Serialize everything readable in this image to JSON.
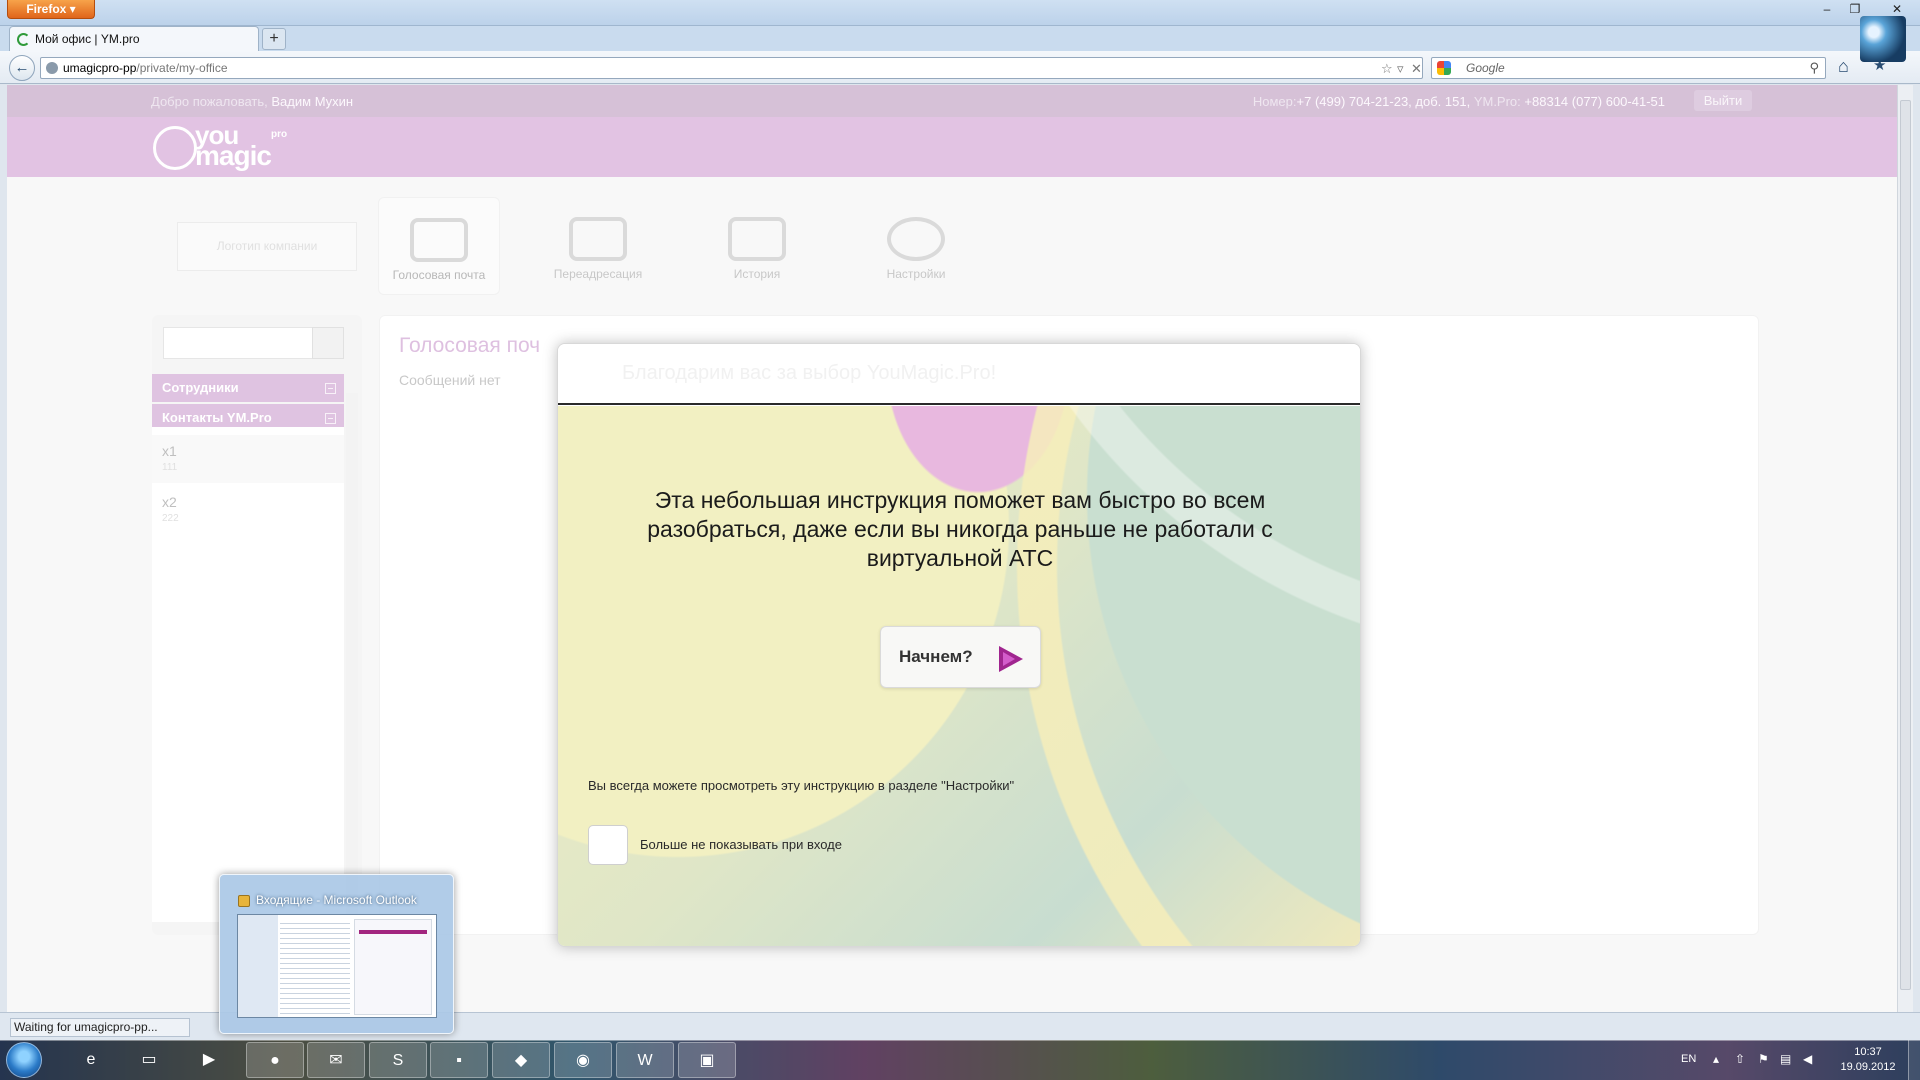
{
  "browser": {
    "app_button": "Firefox",
    "tab_title": "Мой офис | YM.pro",
    "new_tab": "+",
    "url_host": "umagicpro-pp",
    "url_path": "/private/my-office",
    "search_placeholder": "Google",
    "status": "Waiting for umagicpro-pp..."
  },
  "header": {
    "welcome_prefix": "Добро пожаловать,",
    "user_name": "Вадим Мухин",
    "number_label": "Номер:",
    "number_value": "+7 (499) 704-21-23, доб. 151,",
    "ympro_label": "YM.Pro:",
    "ympro_value": "+88314 (077) 600-41-51",
    "logout": "Выйти",
    "logo_you": "you",
    "logo_magic": "magic",
    "logo_pro": "pro"
  },
  "nav": {
    "company_logo_placeholder": "Логотип компании",
    "tiles": [
      {
        "label": "Голосовая почта",
        "icon": "voicemail-icon"
      },
      {
        "label": "Переадресация",
        "icon": "call-forwarding-icon"
      },
      {
        "label": "История",
        "icon": "history-icon"
      },
      {
        "label": "Настройки",
        "icon": "settings-gears-icon"
      }
    ]
  },
  "sidebar": {
    "groups": [
      {
        "label": "Сотрудники"
      },
      {
        "label": "Контакты YM.Pro"
      }
    ],
    "contacts": [
      {
        "name": "x1",
        "ext": "111"
      },
      {
        "name": "x2",
        "ext": "222"
      }
    ]
  },
  "main": {
    "title": "Голосовая поч",
    "empty_text": "Сообщений нет"
  },
  "modal": {
    "title": "Благодарим вас за выбор YouMagic.Pro!",
    "intro": "Эта небольшая инструкция поможет вам быстро во всем разобраться, даже если вы никогда раньше не работали с виртуальной АТС",
    "start_button": "Начнем?",
    "hint": "Вы всегда можете просмотреть эту инструкцию в разделе \"Настройки\"",
    "dont_show_label": "Больше не показывать при входе",
    "dont_show_checked": false
  },
  "taskbar": {
    "thumbnail_title": "Входящие - Microsoft Outlook",
    "language": "EN",
    "time": "10:37",
    "date": "19.09.2012",
    "buttons": [
      "ie-icon",
      "explorer-folder-icon",
      "media-player-icon",
      "firefox-icon",
      "outlook-icon",
      "skype-icon",
      "cmd-icon",
      "alien-app-icon",
      "app-round-icon",
      "word-icon",
      "window-app-icon"
    ]
  },
  "colors": {
    "brand_pink": "#ca92cd",
    "header_strip": "#b48fb7",
    "accent_purple": "#a0258f",
    "title_pink": "#c48cc7"
  }
}
